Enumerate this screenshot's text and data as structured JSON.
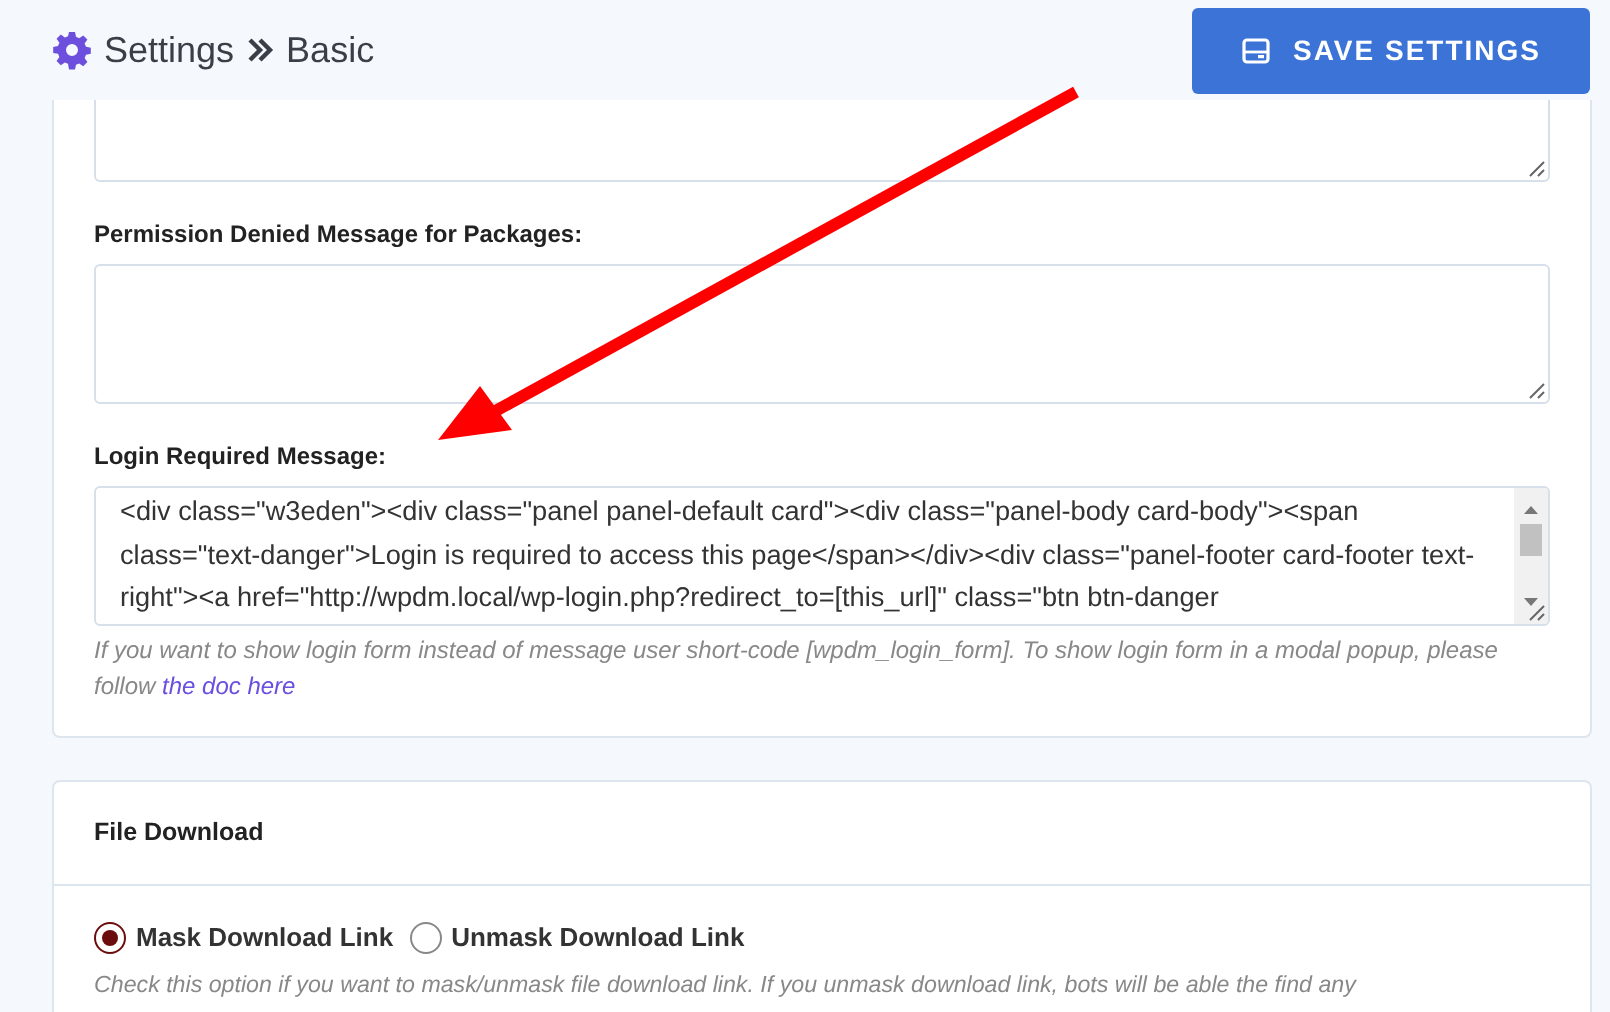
{
  "header": {
    "title": "Settings",
    "subtitle": "Basic",
    "save_button": "SAVE SETTINGS"
  },
  "messages_card": {
    "fields": [
      {
        "kind": "textarea"
      },
      {
        "kind": "textarea",
        "label": "Permission Denied Message for Packages:"
      },
      {
        "kind": "textarea",
        "label": "Login Required Message:",
        "value": "<div class=\"w3eden\"><div class=\"panel panel-default card\"><div class=\"panel-body card-body\"><span class=\"text-danger\">Login is required to access this page</span></div><div class=\"panel-footer card-footer text-right\"><a href=\"http://wpdm.local/wp-login.php?redirect_to=[this_url]\" class=\"btn btn-danger",
        "help": "If you want to show login form instead of message user short-code [wpdm_login_form]. To show login form in a modal popup, please follow ",
        "help_link": "the doc here"
      }
    ]
  },
  "file_download_card": {
    "title": "File Download",
    "options": [
      {
        "label": "Mask Download Link",
        "selected": true
      },
      {
        "label": "Unmask Download Link",
        "selected": false
      }
    ],
    "help": "Check this option if you want to mask/unmask file download link. If you unmask download link, bots will be able the find any"
  }
}
